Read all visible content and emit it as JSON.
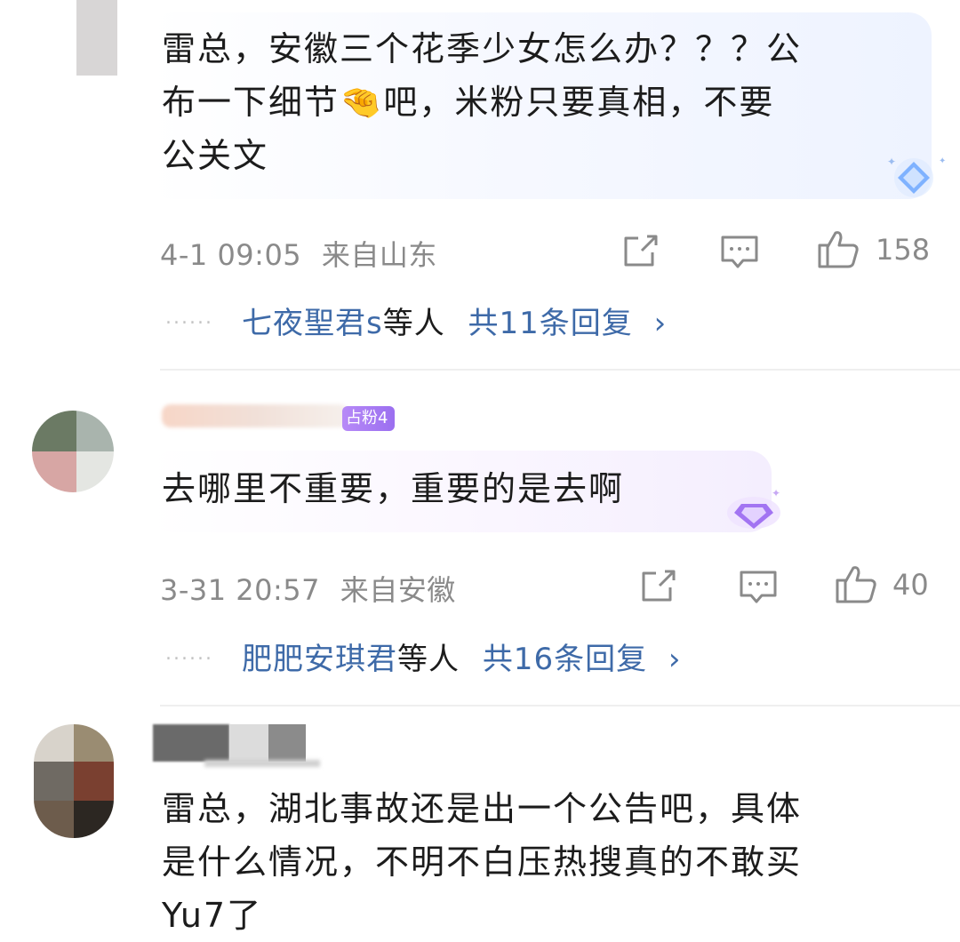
{
  "comments": [
    {
      "text_lines": [
        "雷总，安徽三个花季少女怎么办？？？公",
        "布一下细节🤏吧，米粉只要真相，不要",
        "公关文"
      ],
      "time": "4-1 09:05",
      "location": "来自山东",
      "likes": "158",
      "replies_names": "七夜聖君s",
      "replies_suffix": "等人",
      "replies_count": "共11条回复",
      "replies_dots": "......"
    },
    {
      "badge": "占粉4",
      "text_lines": [
        "去哪里不重要，重要的是去啊"
      ],
      "time": "3-31 20:57",
      "location": "来自安徽",
      "likes": "40",
      "replies_names": "肥肥安琪君",
      "replies_suffix": "等人",
      "replies_count": "共16条回复",
      "replies_dots": "......"
    },
    {
      "text_lines": [
        "雷总，湖北事故还是出一个公告吧，具体",
        "是什么情况，不明不白压热搜真的不敢买",
        "Yu7了"
      ]
    }
  ],
  "icons": {
    "share": "share-icon",
    "comment": "comment-icon",
    "like": "thumbs-up-icon",
    "chevron": "chevron-right-icon",
    "gem": "diamond-gem-icon"
  },
  "colors": {
    "link": "#3e6aa8",
    "meta": "#8a8a8a",
    "badge": "#9b6ff0"
  }
}
